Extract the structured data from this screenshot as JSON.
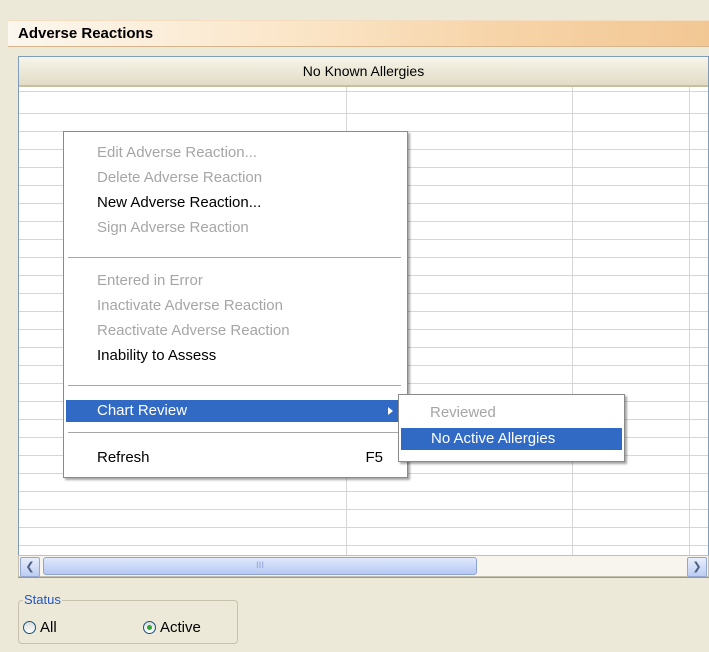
{
  "panel": {
    "title": "Adverse Reactions"
  },
  "grid": {
    "column_header": "No Known Allergies"
  },
  "context_menu": {
    "items": [
      {
        "label": "Edit Adverse Reaction...",
        "enabled": false
      },
      {
        "label": "Delete Adverse Reaction",
        "enabled": false
      },
      {
        "label": "New Adverse Reaction...",
        "enabled": true
      },
      {
        "label": "Sign Adverse Reaction",
        "enabled": false
      },
      {
        "label": "Entered in Error",
        "enabled": false
      },
      {
        "label": "Inactivate Adverse Reaction",
        "enabled": false
      },
      {
        "label": "Reactivate Adverse Reaction",
        "enabled": false
      },
      {
        "label": "Inability to Assess",
        "enabled": true
      },
      {
        "label": "Chart Review",
        "enabled": true,
        "highlighted": true,
        "has_submenu": true
      },
      {
        "label": "Refresh",
        "enabled": true,
        "shortcut": "F5"
      }
    ]
  },
  "submenu": {
    "items": [
      {
        "label": "Reviewed",
        "enabled": false
      },
      {
        "label": "No Active Allergies",
        "enabled": true,
        "highlighted": true
      }
    ]
  },
  "status": {
    "legend": "Status",
    "options": [
      {
        "label": "All",
        "selected": false
      },
      {
        "label": "Active",
        "selected": true
      }
    ]
  },
  "scrollbar": {
    "grip": "III"
  },
  "colors": {
    "highlight": "#316ac5",
    "disabled_text": "#a6a6a6",
    "status_legend": "#1f55c8"
  }
}
